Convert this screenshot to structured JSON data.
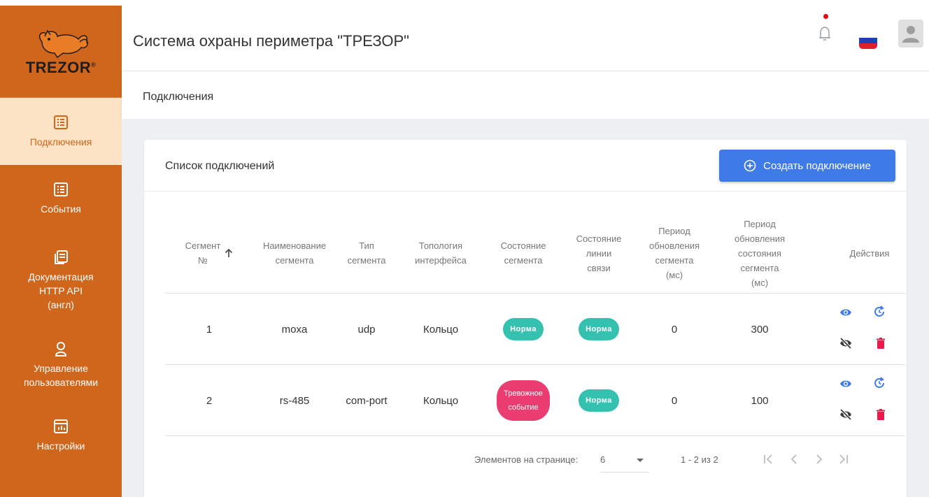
{
  "logo": {
    "text": "TREZOR",
    "mark": "®"
  },
  "sidebar": {
    "items": [
      {
        "label": "Подключения",
        "icon": "list-icon",
        "active": true
      },
      {
        "label": "События",
        "icon": "list-icon"
      },
      {
        "label": "Документация\nHTTP API\n(англ)",
        "icon": "document-icon"
      },
      {
        "label": "Управление\nпользователями",
        "icon": "user-icon"
      },
      {
        "label": "Настройки",
        "icon": "settings-panel-icon"
      }
    ]
  },
  "header": {
    "title": "Система охраны периметра \"ТРЕЗОР\""
  },
  "breadcrumb": {
    "current": "Подключения"
  },
  "card": {
    "title": "Список подключений",
    "create_label": "Создать подключение"
  },
  "table": {
    "columns": [
      "Сегмент\n№",
      "Наименование\nсегмента",
      "Тип\nсегмента",
      "Топология\nинтерфейса",
      "Состояние\nсегмента",
      "Состояние\nлинии\nсвязи",
      "Период\nобновления\nсегмента\n(мс)",
      "Период\nобновления\nсостояния\nсегмента\n(мс)",
      "Действия"
    ],
    "rows": [
      {
        "num": "1",
        "name": "moxa",
        "type": "udp",
        "topology": "Кольцо",
        "segment_state": "Норма",
        "link_state": "Норма",
        "period": "0",
        "state_period": "300"
      },
      {
        "num": "2",
        "name": "rs-485",
        "type": "com-port",
        "topology": "Кольцо",
        "segment_state": "Тревожное\nсобытие",
        "link_state": "Норма",
        "period": "0",
        "state_period": "100"
      }
    ]
  },
  "paginator": {
    "label": "Элементов на странице:",
    "page_size": "6",
    "range": "1 - 2 из 2"
  },
  "colors": {
    "sidebar": "#d0651c",
    "active_bg": "#fde3c6",
    "primary": "#3f7be8",
    "norm": "#35c1b0",
    "alarm": "#ec3d73",
    "delete": "#e8194c"
  }
}
